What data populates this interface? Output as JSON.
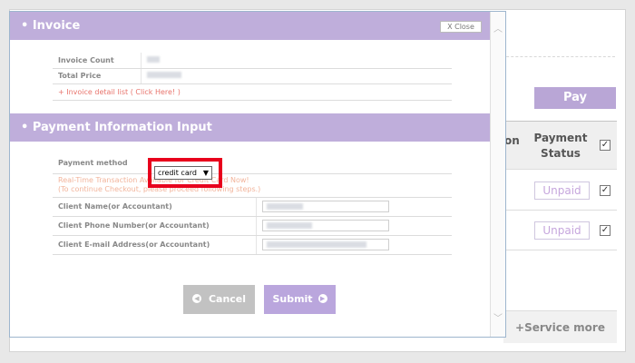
{
  "background": {
    "pay_label": "Pay",
    "col_partial": "on",
    "payment_status_header": "Payment Status",
    "rows": [
      {
        "status": "Unpaid",
        "checked": "✓"
      },
      {
        "status": "Unpaid",
        "checked": "✓"
      }
    ],
    "header_checked": "✓",
    "service_more": "+Service more"
  },
  "modal": {
    "invoice": {
      "title": "• Invoice",
      "close_label": "X Close",
      "rows": [
        {
          "label": "Invoice Count"
        },
        {
          "label": "Total Price"
        }
      ],
      "detail_link": "+ Invoice detail list ( Click Here! )"
    },
    "payment": {
      "title": "• Payment Information Input",
      "method_label": "Payment method",
      "method_value": "credit card",
      "notice_line1": "Real-Time Transaction Available for Credit Card Now!",
      "notice_line2": "(To continue Checkout, please proceed following steps.)",
      "fields": [
        {
          "label": "Client Name(or Accountant)"
        },
        {
          "label": "Client Phone Number(or Accountant)"
        },
        {
          "label": "Client E-mail Address(or Accountant)"
        }
      ]
    },
    "buttons": {
      "cancel": "Cancel",
      "submit": "Submit"
    },
    "colors": {
      "header": "#bfaedb",
      "highlight": "#e8001c",
      "link": "#e8746c"
    }
  }
}
